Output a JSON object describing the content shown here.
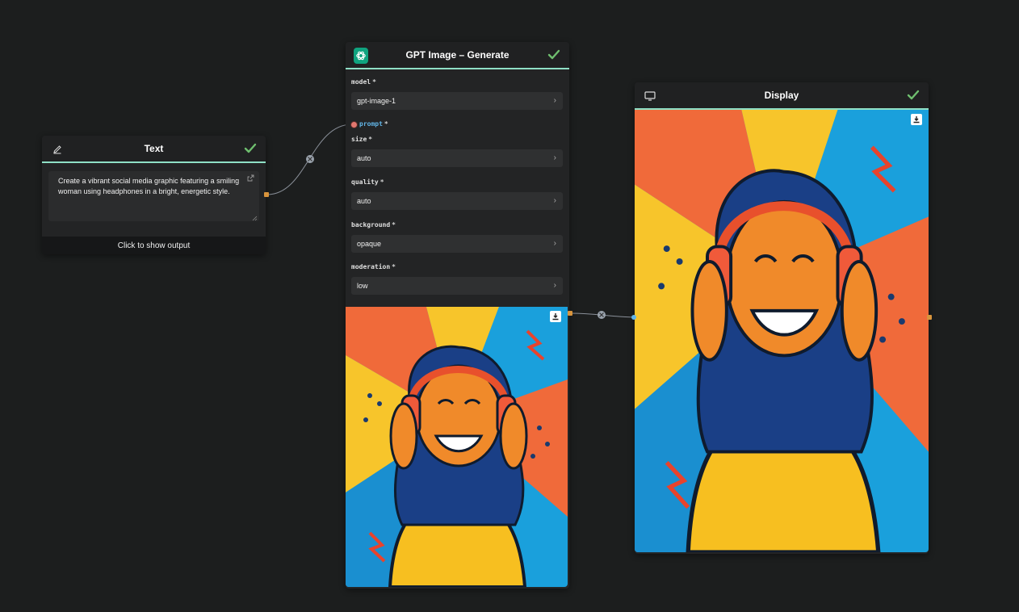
{
  "text_node": {
    "title": "Text",
    "prompt_text": "Create a vibrant social media graphic featuring a smiling woman using headphones in a bright, energetic style.",
    "footer": "Click to show output"
  },
  "gpt_node": {
    "title": "GPT Image – Generate",
    "params": {
      "model": {
        "label": "model",
        "value": "gpt-image-1"
      },
      "prompt": {
        "label": "prompt"
      },
      "size": {
        "label": "size",
        "value": "auto"
      },
      "quality": {
        "label": "quality",
        "value": "auto"
      },
      "background": {
        "label": "background",
        "value": "opaque"
      },
      "moderation": {
        "label": "moderation",
        "value": "low"
      }
    },
    "required_mark": "*"
  },
  "display_node": {
    "title": "Display"
  },
  "colors": {
    "canvas": "#1c1e1e",
    "node_bg": "#232425",
    "header_accent": "#8fe0c6",
    "check": "#6fbf6f",
    "prompt_port": "#e2776f",
    "port_orange": "#d8943c",
    "connector": "#8a9099"
  },
  "icons": {
    "text_node": "pencil-icon",
    "gpt_node": "openai-logo-icon",
    "display_node": "monitor-icon",
    "status": "check-icon",
    "download": "download-icon"
  }
}
